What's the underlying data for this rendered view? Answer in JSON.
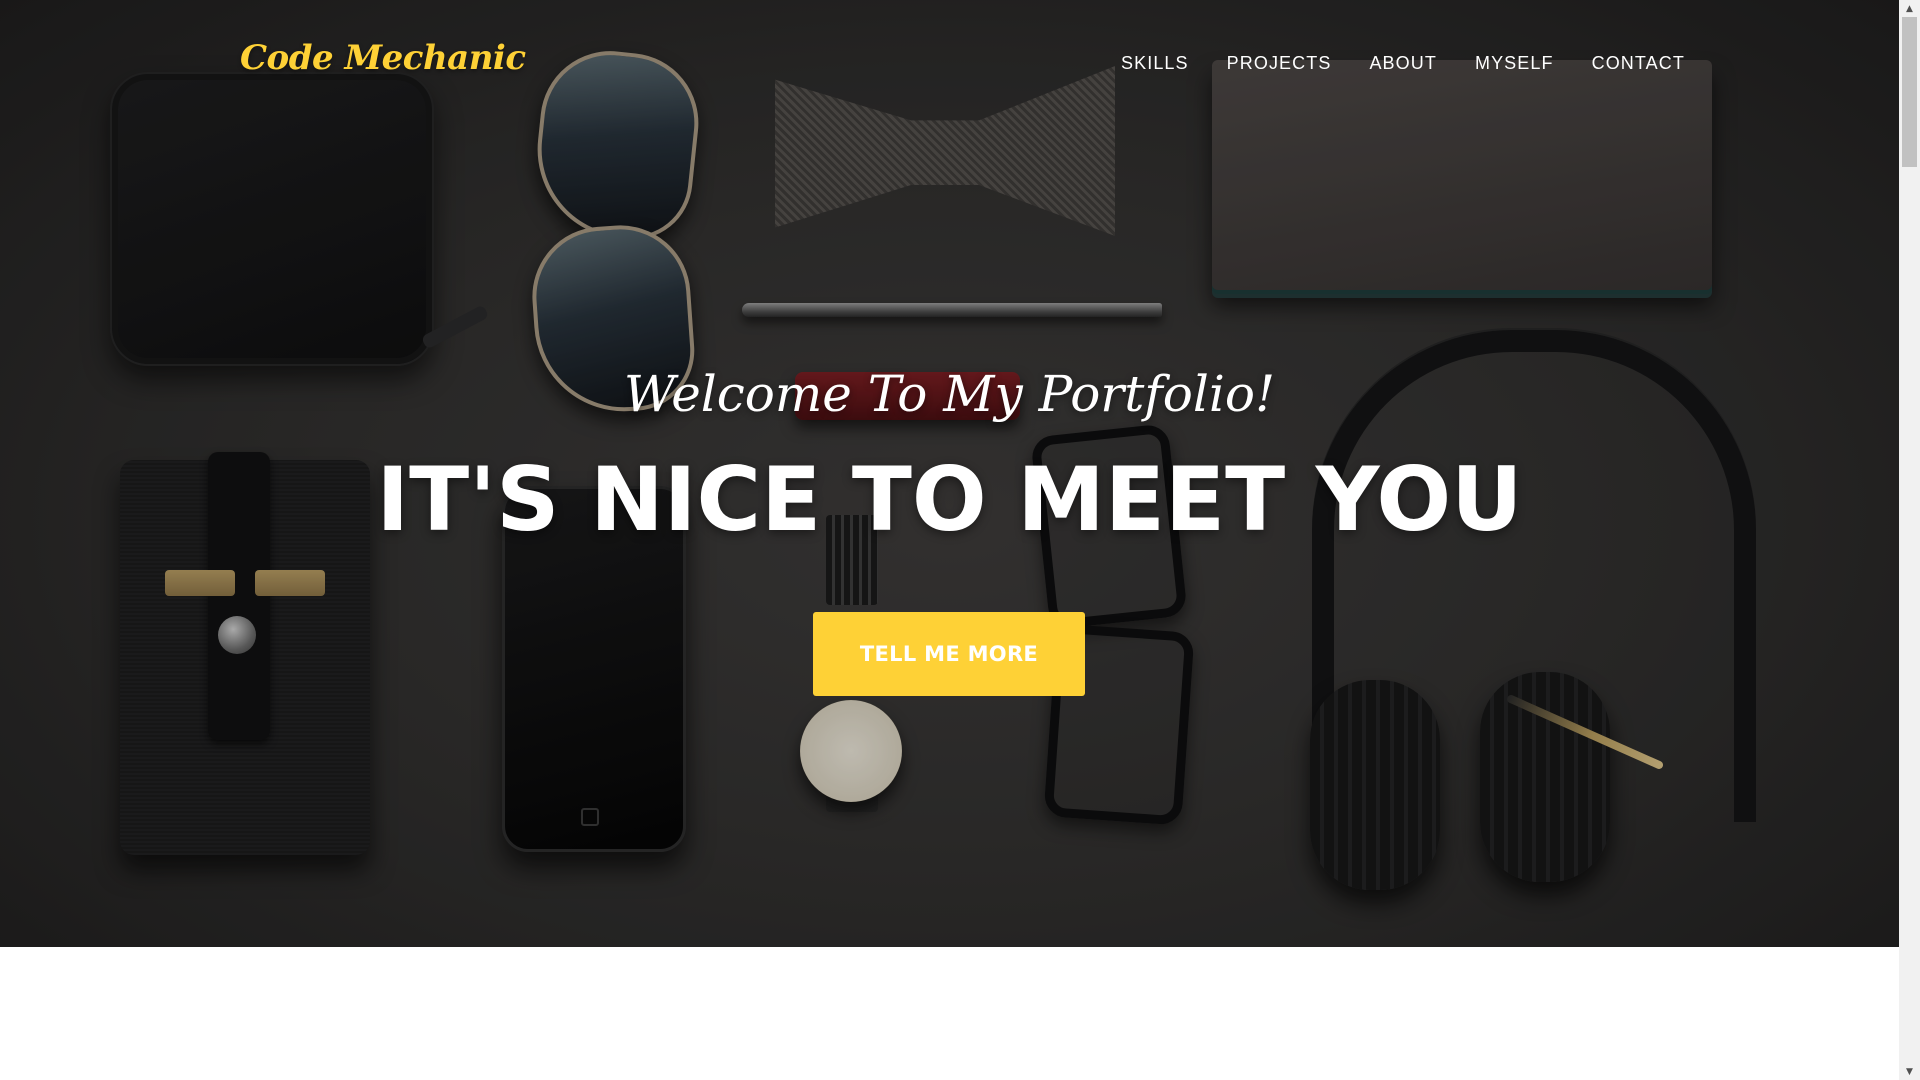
{
  "navbar": {
    "brand": "Code Mechanic",
    "items": [
      {
        "label": "SKILLS"
      },
      {
        "label": "PROJECTS"
      },
      {
        "label": "ABOUT"
      },
      {
        "label": "MYSELF"
      },
      {
        "label": "CONTACT"
      }
    ]
  },
  "hero": {
    "subheading": "Welcome To My Portfolio!",
    "heading": "IT'S NICE TO MEET YOU",
    "cta_label": "TELL ME MORE",
    "background_image": "flat-lay of wallet, sunglasses, bow tie, pen, notebook, phone case, phone, watch, glasses and headphones on a dark surface"
  },
  "colors": {
    "accent": "#fed136",
    "hero_text": "#ffffff",
    "page_background": "#ffffff"
  },
  "scrollbar": {
    "up_icon": "chevron-up-icon",
    "down_icon": "chevron-down-icon"
  }
}
